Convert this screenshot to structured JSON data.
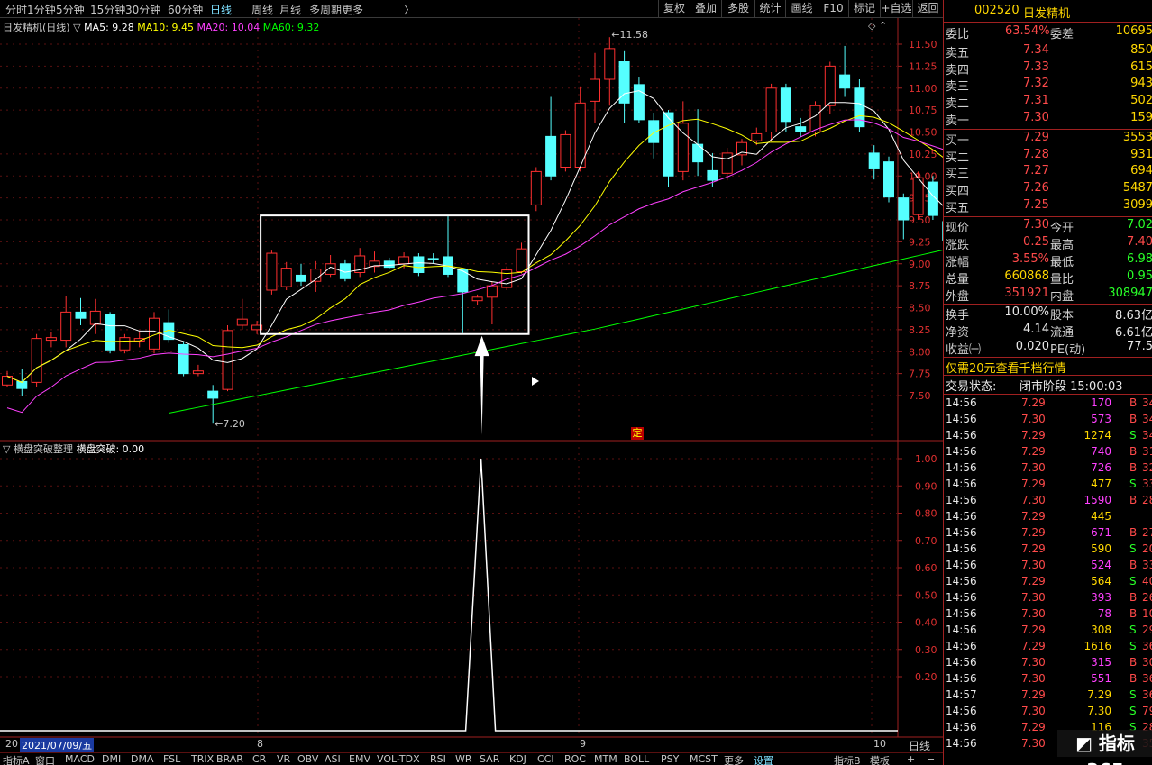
{
  "toolbar": {
    "periods": [
      "分时",
      "1分钟",
      "5分钟",
      "15分钟",
      "30分钟",
      "60分钟",
      "日线",
      "周线",
      "月线",
      "多周期",
      "更多"
    ],
    "active_period": "日线",
    "buttons": [
      "复权",
      "叠加",
      "多股",
      "统计",
      "画线",
      "F10",
      "标记",
      "+自选",
      "返回"
    ]
  },
  "chart": {
    "title": "日发精机(日线)",
    "legend": [
      {
        "label": "MA5: 9.28",
        "color": "#ffffff"
      },
      {
        "label": "MA10: 9.45",
        "color": "#ffff00"
      },
      {
        "label": "MA20: 10.04",
        "color": "#ff40ff"
      },
      {
        "label": "MA60: 9.32",
        "color": "#00ff00"
      }
    ],
    "high_label": "11.58",
    "low_label": "7.20",
    "marker": "定",
    "price_ticks": [
      "11.50",
      "11.25",
      "11.00",
      "10.75",
      "10.50",
      "10.25",
      "10.00",
      "9.75",
      "9.50",
      "9.25",
      "9.00",
      "8.75",
      "8.50",
      "8.25",
      "8.00",
      "7.75",
      "7.50"
    ],
    "indicator_title": "横盘突破整理",
    "indicator_value": "横盘突破: 0.00",
    "indicator_ticks": [
      "1.00",
      "0.90",
      "0.80",
      "0.70",
      "0.60",
      "0.50",
      "0.40",
      "0.30",
      "0.20"
    ],
    "date_left": "20",
    "date_cursor": "2021/07/09/五",
    "month_labels": [
      "8",
      "9",
      "10"
    ],
    "period_label": "日线"
  },
  "chart_data": {
    "type": "candlestick",
    "candles": [
      {
        "o": 7.62,
        "c": 7.72,
        "h": 7.78,
        "l": 7.6
      },
      {
        "o": 7.66,
        "c": 7.58,
        "h": 7.8,
        "l": 7.5
      },
      {
        "o": 7.65,
        "c": 8.15,
        "h": 8.2,
        "l": 7.6
      },
      {
        "o": 8.13,
        "c": 8.16,
        "h": 8.22,
        "l": 8.05
      },
      {
        "o": 8.13,
        "c": 8.45,
        "h": 8.63,
        "l": 8.05
      },
      {
        "o": 8.45,
        "c": 8.38,
        "h": 8.61,
        "l": 8.3
      },
      {
        "o": 8.31,
        "c": 8.46,
        "h": 8.6,
        "l": 8.2
      },
      {
        "o": 8.42,
        "c": 8.02,
        "h": 8.45,
        "l": 7.98
      },
      {
        "o": 8.02,
        "c": 8.16,
        "h": 8.2,
        "l": 7.98
      },
      {
        "o": 8.12,
        "c": 8.15,
        "h": 8.22,
        "l": 8.05
      },
      {
        "o": 8.03,
        "c": 8.38,
        "h": 8.45,
        "l": 7.98
      },
      {
        "o": 8.33,
        "c": 8.14,
        "h": 8.48,
        "l": 8.1
      },
      {
        "o": 8.08,
        "c": 7.75,
        "h": 8.12,
        "l": 7.72
      },
      {
        "o": 7.75,
        "c": 7.78,
        "h": 7.85,
        "l": 7.72
      },
      {
        "o": 7.55,
        "c": 7.47,
        "h": 7.62,
        "l": 7.18
      },
      {
        "o": 7.57,
        "c": 8.24,
        "h": 8.3,
        "l": 7.55
      },
      {
        "o": 8.3,
        "c": 8.37,
        "h": 8.6,
        "l": 8.25
      },
      {
        "o": 8.25,
        "c": 8.3,
        "h": 8.35,
        "l": 8.2
      },
      {
        "o": 8.7,
        "c": 9.12,
        "h": 9.15,
        "l": 8.65
      },
      {
        "o": 8.74,
        "c": 8.95,
        "h": 9.02,
        "l": 8.7
      },
      {
        "o": 8.87,
        "c": 8.8,
        "h": 9.0,
        "l": 8.75
      },
      {
        "o": 8.8,
        "c": 8.94,
        "h": 9.03,
        "l": 8.68
      },
      {
        "o": 8.88,
        "c": 9.0,
        "h": 9.1,
        "l": 8.85
      },
      {
        "o": 9.0,
        "c": 8.83,
        "h": 9.05,
        "l": 8.8
      },
      {
        "o": 8.9,
        "c": 9.09,
        "h": 9.18,
        "l": 8.85
      },
      {
        "o": 8.97,
        "c": 9.03,
        "h": 9.14,
        "l": 8.9
      },
      {
        "o": 9.03,
        "c": 8.96,
        "h": 9.07,
        "l": 8.94
      },
      {
        "o": 9.0,
        "c": 9.08,
        "h": 9.13,
        "l": 8.95
      },
      {
        "o": 9.08,
        "c": 8.9,
        "h": 9.12,
        "l": 8.86
      },
      {
        "o": 9.06,
        "c": 9.05,
        "h": 9.12,
        "l": 9.0
      },
      {
        "o": 9.08,
        "c": 8.88,
        "h": 9.54,
        "l": 8.85
      },
      {
        "o": 8.94,
        "c": 8.68,
        "h": 8.95,
        "l": 8.21
      },
      {
        "o": 8.58,
        "c": 8.62,
        "h": 8.65,
        "l": 8.53
      },
      {
        "o": 8.62,
        "c": 8.75,
        "h": 8.8,
        "l": 8.31
      },
      {
        "o": 8.73,
        "c": 8.93,
        "h": 8.97,
        "l": 8.7
      },
      {
        "o": 8.91,
        "c": 9.17,
        "h": 9.24,
        "l": 8.89
      },
      {
        "o": 9.67,
        "c": 10.05,
        "h": 10.1,
        "l": 9.6
      },
      {
        "o": 10.45,
        "c": 10.0,
        "h": 10.9,
        "l": 9.95
      },
      {
        "o": 10.1,
        "c": 10.47,
        "h": 10.52,
        "l": 10.05
      },
      {
        "o": 10.1,
        "c": 10.83,
        "h": 11.02,
        "l": 10.05
      },
      {
        "o": 10.85,
        "c": 11.1,
        "h": 11.4,
        "l": 10.6
      },
      {
        "o": 11.1,
        "c": 11.45,
        "h": 11.58,
        "l": 10.8
      },
      {
        "o": 11.3,
        "c": 10.83,
        "h": 11.42,
        "l": 10.6
      },
      {
        "o": 11.04,
        "c": 10.64,
        "h": 11.12,
        "l": 10.6
      },
      {
        "o": 10.63,
        "c": 10.38,
        "h": 10.72,
        "l": 10.2
      },
      {
        "o": 10.72,
        "c": 10.0,
        "h": 10.75,
        "l": 9.88
      },
      {
        "o": 10.05,
        "c": 10.6,
        "h": 10.85,
        "l": 9.95
      },
      {
        "o": 10.36,
        "c": 10.16,
        "h": 10.76,
        "l": 10.0
      },
      {
        "o": 10.06,
        "c": 9.95,
        "h": 10.26,
        "l": 9.88
      },
      {
        "o": 10.03,
        "c": 10.26,
        "h": 10.32,
        "l": 9.95
      },
      {
        "o": 10.24,
        "c": 10.38,
        "h": 10.42,
        "l": 10.12
      },
      {
        "o": 10.4,
        "c": 10.48,
        "h": 10.55,
        "l": 10.35
      },
      {
        "o": 10.5,
        "c": 11.0,
        "h": 11.05,
        "l": 10.4
      },
      {
        "o": 11.0,
        "c": 10.62,
        "h": 11.05,
        "l": 10.5
      },
      {
        "o": 10.56,
        "c": 10.51,
        "h": 10.66,
        "l": 10.44
      },
      {
        "o": 10.5,
        "c": 10.8,
        "h": 10.85,
        "l": 10.45
      },
      {
        "o": 10.8,
        "c": 11.25,
        "h": 11.3,
        "l": 10.7
      },
      {
        "o": 11.15,
        "c": 11.0,
        "h": 11.48,
        "l": 10.9
      },
      {
        "o": 11.0,
        "c": 10.56,
        "h": 11.1,
        "l": 10.5
      },
      {
        "o": 10.26,
        "c": 10.08,
        "h": 10.35,
        "l": 9.96
      },
      {
        "o": 10.16,
        "c": 9.76,
        "h": 10.22,
        "l": 9.7
      },
      {
        "o": 9.75,
        "c": 9.5,
        "h": 9.8,
        "l": 9.28
      },
      {
        "o": 9.56,
        "c": 9.98,
        "h": 10.05,
        "l": 9.5
      },
      {
        "o": 9.93,
        "c": 9.55,
        "h": 10.0,
        "l": 9.5
      },
      {
        "o": 9.48,
        "c": 9.27,
        "h": 9.55,
        "l": 9.18
      },
      {
        "o": 9.27,
        "c": 9.05,
        "h": 9.3,
        "l": 9.0
      },
      {
        "o": 9.2,
        "c": 9.35,
        "h": 9.5,
        "l": 9.1
      },
      {
        "o": 9.25,
        "c": 9.3,
        "h": 9.45,
        "l": 9.05
      },
      {
        "o": 9.35,
        "c": 9.42,
        "h": 9.48,
        "l": 9.3
      },
      {
        "o": 9.42,
        "c": 9.35,
        "h": 9.45,
        "l": 9.32
      },
      {
        "o": 9.31,
        "c": 9.29,
        "h": 9.37,
        "l": 9.06
      },
      {
        "o": 9.3,
        "c": 8.88,
        "h": 9.3,
        "l": 8.8
      }
    ],
    "indicator": {
      "name": "横盘突破",
      "spike_value": 1.0,
      "spike_candle_index": 36
    },
    "ylim": [
      7.25,
      11.7
    ]
  },
  "panel": {
    "code": "002520",
    "name": "日发精机",
    "weibi_label": "委比",
    "weibi_value": "63.54%",
    "weicha_label": "委差",
    "weicha_value": "10695",
    "asks": [
      {
        "label": "卖五",
        "price": "7.34",
        "vol": "850"
      },
      {
        "label": "卖四",
        "price": "7.33",
        "vol": "615"
      },
      {
        "label": "卖三",
        "price": "7.32",
        "vol": "943"
      },
      {
        "label": "卖二",
        "price": "7.31",
        "vol": "502"
      },
      {
        "label": "卖一",
        "price": "7.30",
        "vol": "159"
      }
    ],
    "bids": [
      {
        "label": "买一",
        "price": "7.29",
        "vol": "3553"
      },
      {
        "label": "买二",
        "price": "7.28",
        "vol": "931"
      },
      {
        "label": "买三",
        "price": "7.27",
        "vol": "694"
      },
      {
        "label": "买四",
        "price": "7.26",
        "vol": "5487"
      },
      {
        "label": "买五",
        "price": "7.25",
        "vol": "3099"
      }
    ],
    "quote": [
      {
        "l1": "现价",
        "v1": "7.30",
        "l2": "今开",
        "v2": "7.02",
        "c1": "c-red",
        "c2": "c-grn"
      },
      {
        "l1": "涨跌",
        "v1": "0.25",
        "l2": "最高",
        "v2": "7.40",
        "c1": "c-red",
        "c2": "c-red"
      },
      {
        "l1": "涨幅",
        "v1": "3.55%",
        "l2": "最低",
        "v2": "6.98",
        "c1": "c-red",
        "c2": "c-grn"
      },
      {
        "l1": "总量",
        "v1": "660868",
        "l2": "量比",
        "v2": "0.95",
        "c1": "c-yel",
        "c2": "c-grn"
      },
      {
        "l1": "外盘",
        "v1": "351921",
        "l2": "内盘",
        "v2": "308947",
        "c1": "c-red",
        "c2": "c-grn"
      }
    ],
    "fund": [
      {
        "l1": "换手",
        "v1": "10.00%",
        "l2": "股本",
        "v2": "8.63亿"
      },
      {
        "l1": "净资",
        "v1": "4.14",
        "l2": "流通",
        "v2": "6.61亿"
      },
      {
        "l1": "收益㈠",
        "v1": "0.020",
        "l2": "PE(动)",
        "v2": "77.5"
      }
    ],
    "promo": "仅需20元查看千档行情",
    "status_label": "交易状态:",
    "status_value": "闭市阶段 15:00:03",
    "ticks": [
      {
        "t": "14:56",
        "p": "7.29",
        "v": "170",
        "bs": "B",
        "n": "34"
      },
      {
        "t": "14:56",
        "p": "7.30",
        "v": "573",
        "bs": "B",
        "n": "34"
      },
      {
        "t": "14:56",
        "p": "7.29",
        "v": "1274",
        "bs": "S",
        "n": "34"
      },
      {
        "t": "14:56",
        "p": "7.29",
        "v": "740",
        "bs": "B",
        "n": "31"
      },
      {
        "t": "14:56",
        "p": "7.30",
        "v": "726",
        "bs": "B",
        "n": "32"
      },
      {
        "t": "14:56",
        "p": "7.29",
        "v": "477",
        "bs": "S",
        "n": "33"
      },
      {
        "t": "14:56",
        "p": "7.30",
        "v": "1590",
        "bs": "B",
        "n": "28"
      },
      {
        "t": "14:56",
        "p": "7.29",
        "v": "445",
        "bs": "",
        "n": ""
      },
      {
        "t": "14:56",
        "p": "7.29",
        "v": "671",
        "bs": "B",
        "n": "27"
      },
      {
        "t": "14:56",
        "p": "7.29",
        "v": "590",
        "bs": "S",
        "n": "20"
      },
      {
        "t": "14:56",
        "p": "7.30",
        "v": "524",
        "bs": "B",
        "n": "33"
      },
      {
        "t": "14:56",
        "p": "7.29",
        "v": "564",
        "bs": "S",
        "n": "40"
      },
      {
        "t": "14:56",
        "p": "7.30",
        "v": "393",
        "bs": "B",
        "n": "26"
      },
      {
        "t": "14:56",
        "p": "7.30",
        "v": "78",
        "bs": "B",
        "n": "10"
      },
      {
        "t": "14:56",
        "p": "7.29",
        "v": "308",
        "bs": "S",
        "n": "29"
      },
      {
        "t": "14:56",
        "p": "7.29",
        "v": "1616",
        "bs": "S",
        "n": "36"
      },
      {
        "t": "14:56",
        "p": "7.30",
        "v": "315",
        "bs": "B",
        "n": "30"
      },
      {
        "t": "14:56",
        "p": "7.30",
        "v": "551",
        "bs": "B",
        "n": "36"
      },
      {
        "t": "14:57",
        "p": "7.29",
        "v": "7.29",
        "bs": "S",
        "n": "36"
      },
      {
        "t": "14:56",
        "p": "7.30",
        "v": "7.30",
        "bs": "S",
        "n": "79"
      },
      {
        "t": "14:56",
        "p": "7.29",
        "v": "116",
        "bs": "S",
        "n": "28"
      },
      {
        "t": "14:56",
        "p": "7.30",
        "v": "",
        "bs": "",
        "n": "35"
      }
    ],
    "brand": "指标365"
  },
  "bottom_tabs": [
    "指标A",
    "窗口",
    "MACD",
    "DMI",
    "DMA",
    "FSL",
    "TRIX",
    "BRAR",
    "CR",
    "VR",
    "OBV",
    "ASI",
    "EMV",
    "VOL-TDX",
    "RSI",
    "WR",
    "SAR",
    "KDJ",
    "CCI",
    "ROC",
    "MTM",
    "BOLL",
    "PSY",
    "MCST",
    "更多",
    "设置"
  ],
  "bottom_right": [
    "指标B",
    "模板"
  ],
  "colors": {
    "up": "#ff3030",
    "down": "#55ffff",
    "ma5": "#ffffff",
    "ma10": "#ffff00",
    "ma20": "#ff40ff",
    "ma60": "#00ff00",
    "grid": "#5a1010"
  }
}
